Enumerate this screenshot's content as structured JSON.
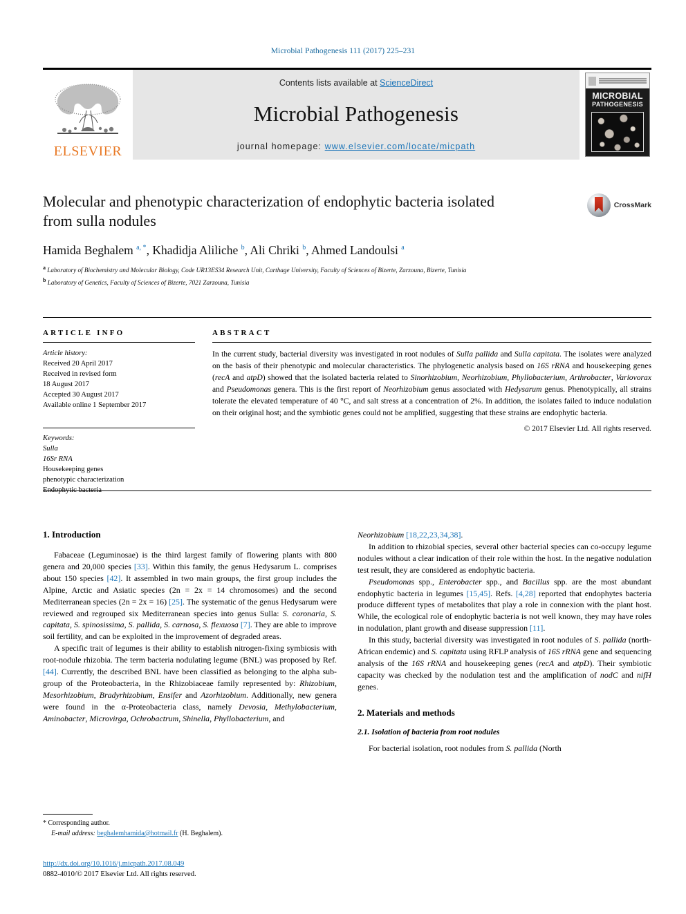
{
  "running_head": "Microbial Pathogenesis 111 (2017) 225–231",
  "masthead": {
    "publisher": "ELSEVIER",
    "contents_prefix": "Contents lists available at ",
    "contents_link": "ScienceDirect",
    "journal_title": "Microbial Pathogenesis",
    "homepage_prefix": "journal homepage: ",
    "homepage_url": "www.elsevier.com/locate/micpath",
    "cover": {
      "line1": "MICROBIAL",
      "line2": "PATHOGENESIS"
    }
  },
  "article": {
    "title": "Molecular and phenotypic characterization of endophytic bacteria isolated from sulla nodules",
    "crossmark_label": "CrossMark",
    "authors_html": "Hamida Beghalem <sup>a, *</sup>, Khadidja Aliliche <sup>b</sup>, Ali Chriki <sup>b</sup>, Ahmed Landoulsi <sup>a</sup>",
    "affiliations": [
      "Laboratory of Biochemistry and Molecular Biology, Code UR13ES34 Research Unit, Carthage University, Faculty of Sciences of Bizerte, Zarzouna, Bizerte, Tunisia",
      "Laboratory of Genetics, Faculty of Sciences of Bizerte, 7021 Zarzouna, Tunisia"
    ],
    "affiliation_marks": [
      "a",
      "b"
    ]
  },
  "article_info": {
    "heading": "ARTICLE INFO",
    "history_label": "Article history:",
    "history": [
      "Received 20 April 2017",
      "Received in revised form",
      "18 August 2017",
      "Accepted 30 August 2017",
      "Available online 1 September 2017"
    ],
    "keywords_label": "Keywords:",
    "keywords": [
      "Sulla",
      "16Sr RNA",
      "Housekeeping genes",
      "phenotypic characterization",
      "Endophytic bacteria"
    ]
  },
  "abstract": {
    "heading": "ABSTRACT",
    "text_html": "In the current study, bacterial diversity was investigated in root nodules of <i>Sulla pallida</i> and <i>Sulla capitata</i>. The isolates were analyzed on the basis of their phenotypic and molecular characteristics. The phylogenetic analysis based on <i>16S rRNA</i> and housekeeping genes (<i>recA</i> and <i>atpD</i>) showed that the isolated bacteria related to <i>Sinorhizobium</i>, <i>Neorhizobium</i>, <i>Phyllobacterium</i>, <i>Arthrobacter</i>, <i>Variovorax</i> and <i>Pseudomonas</i> genera. This is the first report of <i>Neorhizobium</i> genus associated with <i>Hedysarum</i> genus. Phenotypically, all strains tolerate the elevated temperature of 40 °C, and salt stress at a concentration of 2%. In addition, the isolates failed to induce nodulation on their original host; and the symbiotic genes could not be amplified, suggesting that these strains are endophytic bacteria.",
    "copyright": "© 2017 Elsevier Ltd. All rights reserved."
  },
  "body": {
    "left": {
      "section_heading": "1. Introduction",
      "paragraphs_html": [
        "Fabaceae (Leguminosae) is the third largest family of flowering plants with 800 genera and 20,000 species <span class=\"ref\">[33]</span>. Within this family, the genus Hedysarum L. comprises about 150 species <span class=\"ref\">[42]</span>. It assembled in two main groups, the first group includes the Alpine, Arctic and Asiatic species (2n = 2x = 14 chromosomes) and the second Mediterranean species (2n = 2x = 16) <span class=\"ref\">[25]</span>. The systematic of the genus Hedysarum were reviewed and regrouped six Mediterranean species into genus Sulla: <i>S. coronaria</i>, <i>S. capitata</i>, <i>S. spinosissima</i>, <i>S. pallida</i>, <i>S. carnosa</i>, <i>S. flexuosa</i> <span class=\"ref\">[7]</span>. They are able to improve soil fertility, and can be exploited in the improvement of degraded areas.",
        "A specific trait of legumes is their ability to establish nitrogen-fixing symbiosis with root-nodule rhizobia. The term bacteria nodulating legume (BNL) was proposed by Ref. <span class=\"ref\">[44]</span>. Currently, the described BNL have been classified as belonging to the alpha sub-group of the Proteobacteria, in the Rhizobiaceae family represented by: <i>Rhizobium</i>, <i>Mesorhizobium</i>, <i>Bradyrhizobium</i>, <i>Ensifer</i> and <i>Azorhizobium</i>. Additionally, new genera were found in the α-Proteobacteria class, namely <i>Devosia</i>, <i>Methylobacterium</i>, <i>Aminobacter</i>, <i>Microvirga</i>, <i>Ochrobactrum</i>, <i>Shinella</i>, <i>Phyllobacterium</i>, and"
      ]
    },
    "right": {
      "paragraphs_html": [
        "<i>Neorhizobium</i> <span class=\"ref\">[18,22,23,34,38]</span>.",
        "In addition to rhizobial species, several other bacterial species can co-occupy legume nodules without a clear indication of their role within the host. In the negative nodulation test result, they are considered as endophytic bacteria.",
        "<i>Pseudomonas</i> spp., <i>Enterobacter</i> spp., and <i>Bacillus</i> spp. are the most abundant endophytic bacteria in legumes <span class=\"ref\">[15,45]</span>. Refs. <span class=\"ref\">[4,28]</span> reported that endophytes bacteria produce different types of metabolites that play a role in connexion with the plant host. While, the ecological role of endophytic bacteria is not well known, they may have roles in nodulation, plant growth and disease suppression <span class=\"ref\">[11]</span>.",
        "In this study, bacterial diversity was investigated in root nodules of <i>S. pallida</i> (north- African endemic) and <i>S. capitata</i> using RFLP analysis of <i>16S rRNA</i> gene and sequencing analysis of the <i>16S rRNA</i> and housekeeping genes (<i>recA</i> and <i>atpD</i>). Their symbiotic capacity was checked by the nodulation test and the amplification of <i>nodC</i> and <i>nifH</i> genes."
      ],
      "section_heading": "2. Materials and methods",
      "subsection_heading": "2.1. Isolation of bacteria from root nodules",
      "last_paragraph_html": "For bacterial isolation, root nodules from <i>S. pallida</i> (North"
    }
  },
  "footnote": {
    "corresponding_star": "*",
    "corresponding_label": "Corresponding author.",
    "email_label": "E-mail address:",
    "email": "beghalemhamida@hotmail.fr",
    "email_owner": "(H. Beghalem)."
  },
  "doi_block": {
    "doi_url": "http://dx.doi.org/10.1016/j.micpath.2017.08.049",
    "issn_line": "0882-4010/© 2017 Elsevier Ltd. All rights reserved."
  },
  "colors": {
    "link_blue": "#1a74b8",
    "elsevier_orange": "#e87722",
    "masthead_grey": "#e6e6e6"
  }
}
